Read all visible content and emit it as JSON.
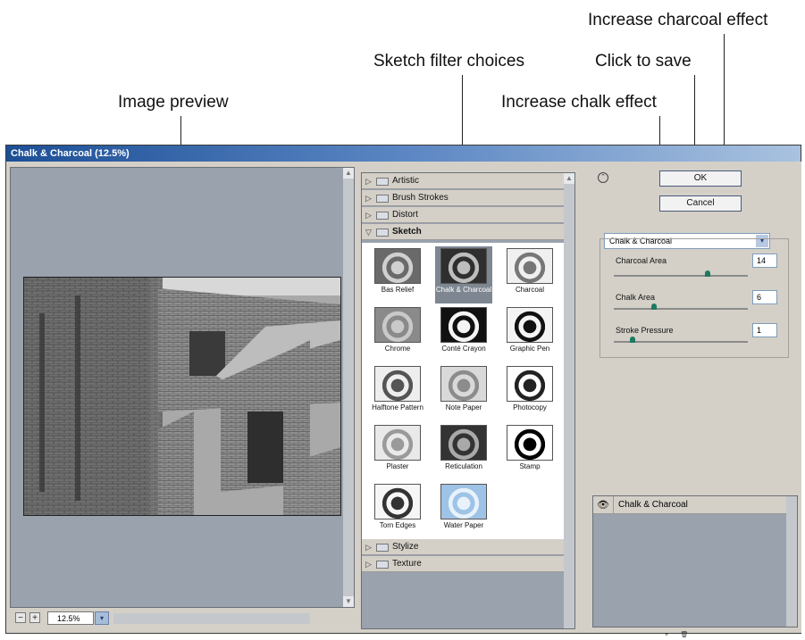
{
  "callouts": {
    "image_preview": "Image preview",
    "sketch_filter_choices": "Sketch filter choices",
    "click_to_save": "Click to save",
    "increase_chalk_effect": "Increase chalk effect",
    "increase_charcoal_effect": "Increase charcoal effect"
  },
  "window": {
    "title": "Chalk & Charcoal (12.5%)"
  },
  "preview": {
    "zoom_minus": "−",
    "zoom_plus": "+",
    "zoom_value": "12.5%",
    "zoom_arrow": "▾"
  },
  "filters": {
    "folders_top": [
      {
        "label": "Artistic",
        "expanded": false,
        "arrow": "▷"
      },
      {
        "label": "Brush Strokes",
        "expanded": false,
        "arrow": "▷"
      },
      {
        "label": "Distort",
        "expanded": false,
        "arrow": "▷"
      },
      {
        "label": "Sketch",
        "expanded": true,
        "arrow": "▽"
      }
    ],
    "thumbnails": [
      {
        "label": "Bas Relief",
        "selected": false
      },
      {
        "label": "Chalk & Charcoal",
        "selected": true
      },
      {
        "label": "Charcoal",
        "selected": false
      },
      {
        "label": "Chrome",
        "selected": false
      },
      {
        "label": "Conté Crayon",
        "selected": false
      },
      {
        "label": "Graphic Pen",
        "selected": false
      },
      {
        "label": "Halftone Pattern",
        "selected": false
      },
      {
        "label": "Note Paper",
        "selected": false
      },
      {
        "label": "Photocopy",
        "selected": false
      },
      {
        "label": "Plaster",
        "selected": false
      },
      {
        "label": "Reticulation",
        "selected": false
      },
      {
        "label": "Stamp",
        "selected": false
      },
      {
        "label": "Torn Edges",
        "selected": false
      },
      {
        "label": "Water Paper",
        "selected": false
      }
    ],
    "folders_bottom": [
      {
        "label": "Stylize",
        "expanded": false,
        "arrow": "▷"
      },
      {
        "label": "Texture",
        "expanded": false,
        "arrow": "▷"
      }
    ]
  },
  "controls": {
    "collapse_icon": "⌃",
    "ok_label": "OK",
    "cancel_label": "Cancel",
    "filter_select": "Chalk & Charcoal",
    "select_arrow": "▾",
    "settings": [
      {
        "label": "Charcoal Area",
        "value": "14",
        "level": 0.7
      },
      {
        "label": "Chalk Area",
        "value": "6",
        "level": 0.3
      },
      {
        "label": "Stroke Pressure",
        "value": "1",
        "level": 0.14
      }
    ]
  },
  "layers": {
    "eye_icon": "👁",
    "items": [
      {
        "label": "Chalk & Charcoal"
      }
    ],
    "new_layer_icon": "+",
    "delete_layer_icon": "🗑"
  },
  "colors": {
    "dialog_bg": "#d4d0c8",
    "pane_bg": "#9aa2ad",
    "title_bar": "#1c4f96",
    "slider_knob": "#1d7a62"
  }
}
